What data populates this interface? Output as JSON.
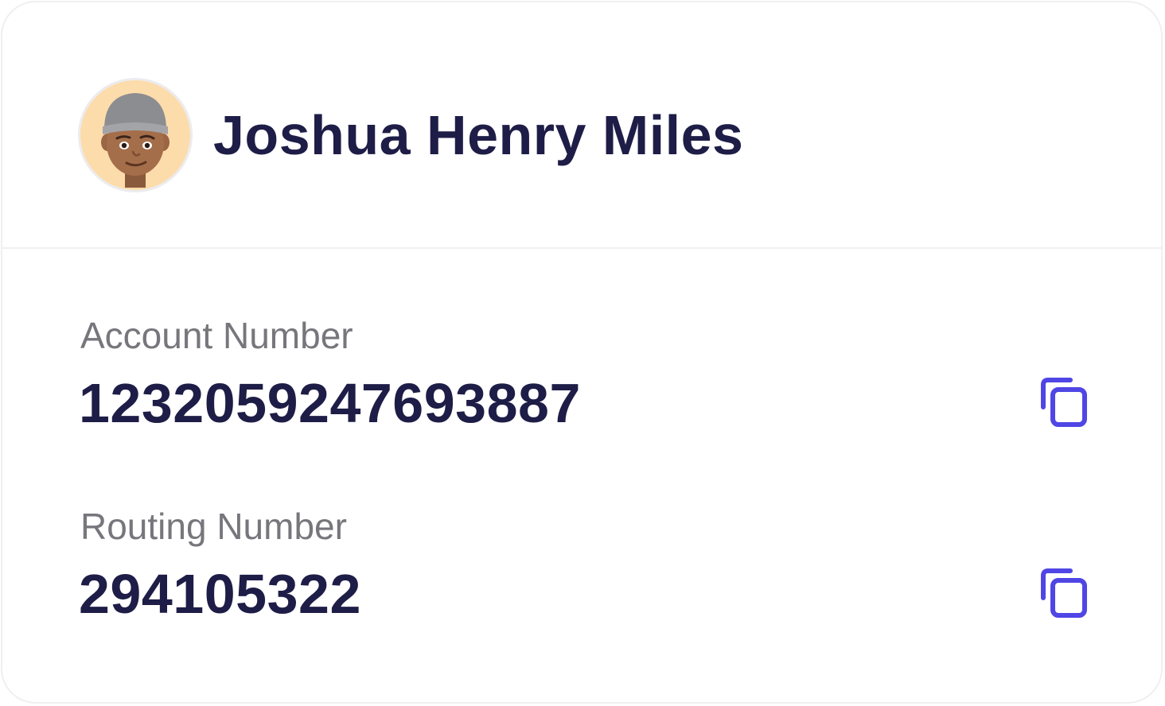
{
  "user": {
    "name": "Joshua Henry Miles",
    "avatar_icon": "memoji-avatar"
  },
  "account": {
    "label": "Account Number",
    "value": "1232059247693887",
    "copy_icon": "copy-icon"
  },
  "routing": {
    "label": "Routing Number",
    "value": "294105322",
    "copy_icon": "copy-icon"
  },
  "colors": {
    "accent": "#4f46e5",
    "text_primary": "#1e1d47",
    "text_secondary": "#76767c",
    "avatar_bg": "#fddcab"
  }
}
